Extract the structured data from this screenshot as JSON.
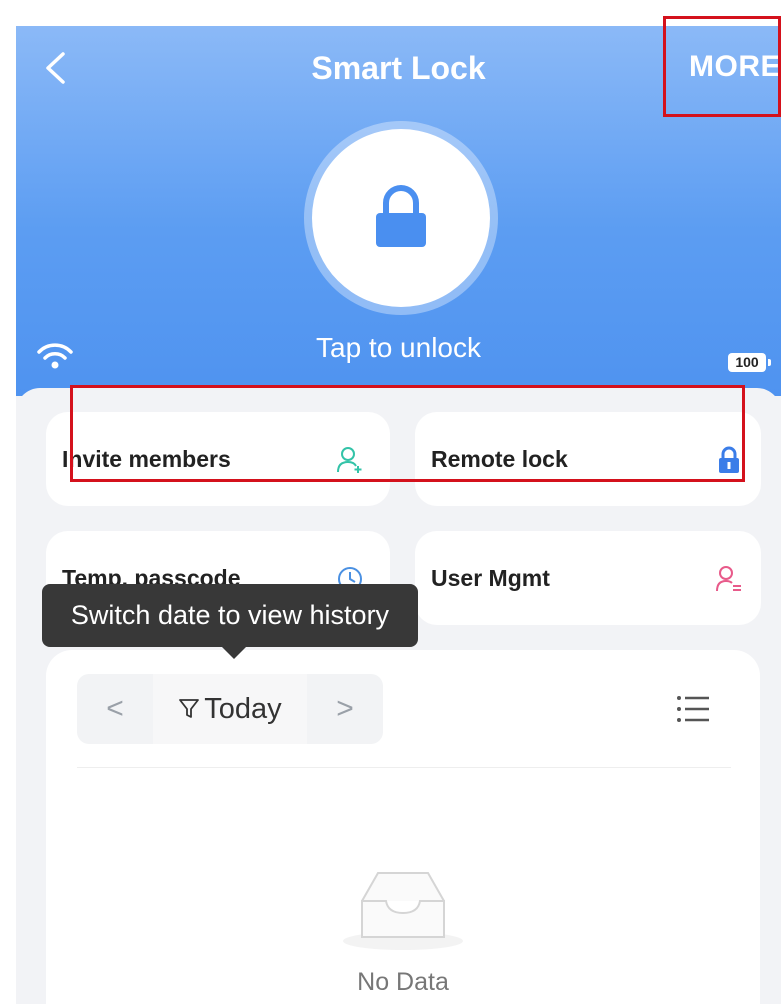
{
  "header": {
    "title": "Smart Lock",
    "more_label": "MORE",
    "lock_status_text": "Tap to unlock",
    "battery_level": "100"
  },
  "quick_actions": [
    {
      "label": "Invite members",
      "icon": "add-user-icon",
      "color": "#33c3a8"
    },
    {
      "label": "Remote lock",
      "icon": "lock-icon",
      "color": "#3b7de8"
    },
    {
      "label": "Temp. passcode",
      "icon": "clock-key-icon",
      "color": "#4a90e2"
    },
    {
      "label": "User Mgmt",
      "icon": "user-list-icon",
      "color": "#e85a8a"
    }
  ],
  "tooltip": {
    "text": "Switch date to view history"
  },
  "history": {
    "date_label": "Today",
    "prev_glyph": "<",
    "next_glyph": ">",
    "empty_text": "No Data"
  },
  "colors": {
    "header_gradient_top": "#8bb9f7",
    "header_gradient_bottom": "#4f93f0",
    "highlight": "#d4111c",
    "lock_blue": "#4a8ff0"
  }
}
